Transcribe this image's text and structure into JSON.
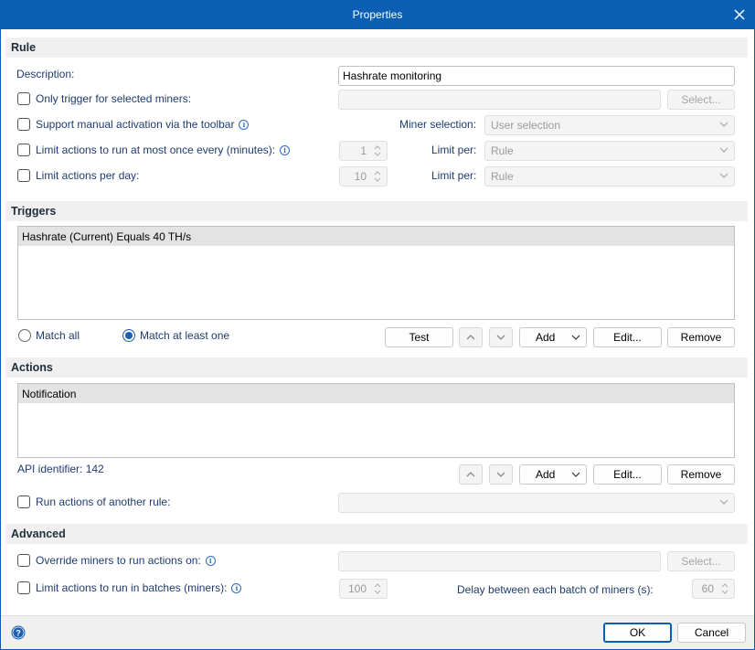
{
  "window": {
    "title": "Properties"
  },
  "rule": {
    "heading": "Rule",
    "description_label": "Description:",
    "description_value": "Hashrate monitoring",
    "only_trigger_label": "Only trigger for selected miners:",
    "select_button": "Select...",
    "manual_activation_label": "Support manual activation via the toolbar",
    "miner_selection_label": "Miner selection:",
    "miner_selection_value": "User selection",
    "limit_once_label": "Limit actions to run at most once every (minutes):",
    "limit_once_value": "1",
    "limit_per_label": "Limit per:",
    "limit_per_value": "Rule",
    "limit_day_label": "Limit actions per day:",
    "limit_day_value": "10",
    "limit_per2_label": "Limit per:",
    "limit_per2_value": "Rule"
  },
  "triggers": {
    "heading": "Triggers",
    "items": [
      "Hashrate (Current) Equals 40 TH/s"
    ],
    "match_all": "Match all",
    "match_at_least_one": "Match at least one",
    "test_button": "Test",
    "add_button": "Add",
    "edit_button": "Edit...",
    "remove_button": "Remove"
  },
  "actions": {
    "heading": "Actions",
    "items": [
      "Notification"
    ],
    "api_identifier": "API identifier: 142",
    "add_button": "Add",
    "edit_button": "Edit...",
    "remove_button": "Remove",
    "run_other_label": "Run actions of another rule:"
  },
  "advanced": {
    "heading": "Advanced",
    "override_label": "Override miners to run actions on:",
    "select_button": "Select...",
    "batches_label": "Limit actions to run in batches (miners):",
    "batches_value": "100",
    "delay_label": "Delay between each batch of miners (s):",
    "delay_value": "60"
  },
  "footer": {
    "ok": "OK",
    "cancel": "Cancel"
  },
  "colors": {
    "accent": "#0a5fb4",
    "label": "#1f3b70",
    "section_bg": "#f0f0f0"
  }
}
